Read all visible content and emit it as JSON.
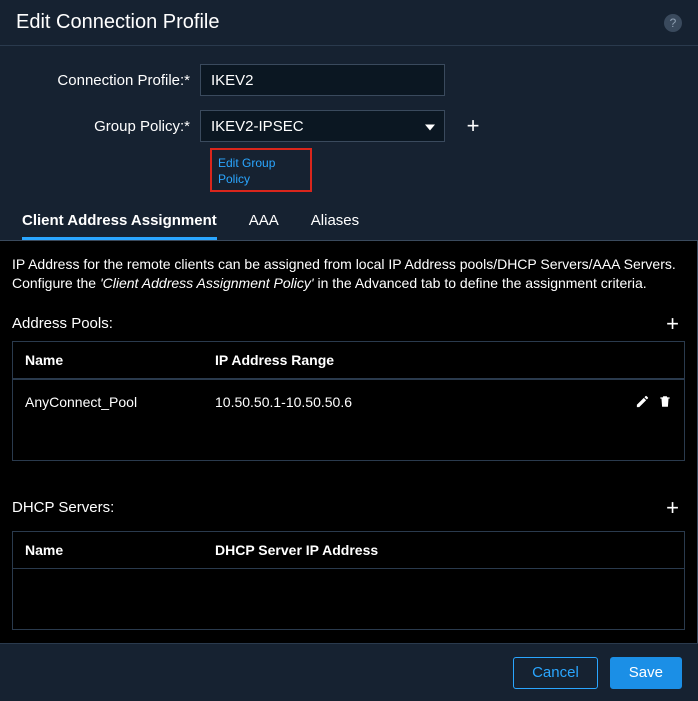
{
  "header": {
    "title": "Edit Connection Profile"
  },
  "form": {
    "conn_label": "Connection Profile:*",
    "conn_value": "IKEV2",
    "gp_label": "Group Policy:*",
    "gp_value": "IKEV2-IPSEC",
    "edit_gp_link": "Edit Group Policy"
  },
  "tabs": {
    "t0": "Client Address Assignment",
    "t1": "AAA",
    "t2": "Aliases"
  },
  "content": {
    "desc_a": "IP Address for the remote clients can be assigned from local IP Address pools/DHCP Servers/AAA Servers. Configure the ",
    "desc_i": "'Client Address Assignment Policy'",
    "desc_b": " in the Advanced tab to define the assignment criteria.",
    "ap_title": "Address Pools:",
    "ap": {
      "col_name": "Name",
      "col_range": "IP Address Range",
      "rows": [
        {
          "name": "AnyConnect_Pool",
          "range": "10.50.50.1-10.50.50.6"
        }
      ]
    },
    "dhcp_title": "DHCP Servers:",
    "dhcp": {
      "col_name": "Name",
      "col_ip": "DHCP Server IP Address"
    }
  },
  "footer": {
    "cancel": "Cancel",
    "save": "Save"
  }
}
